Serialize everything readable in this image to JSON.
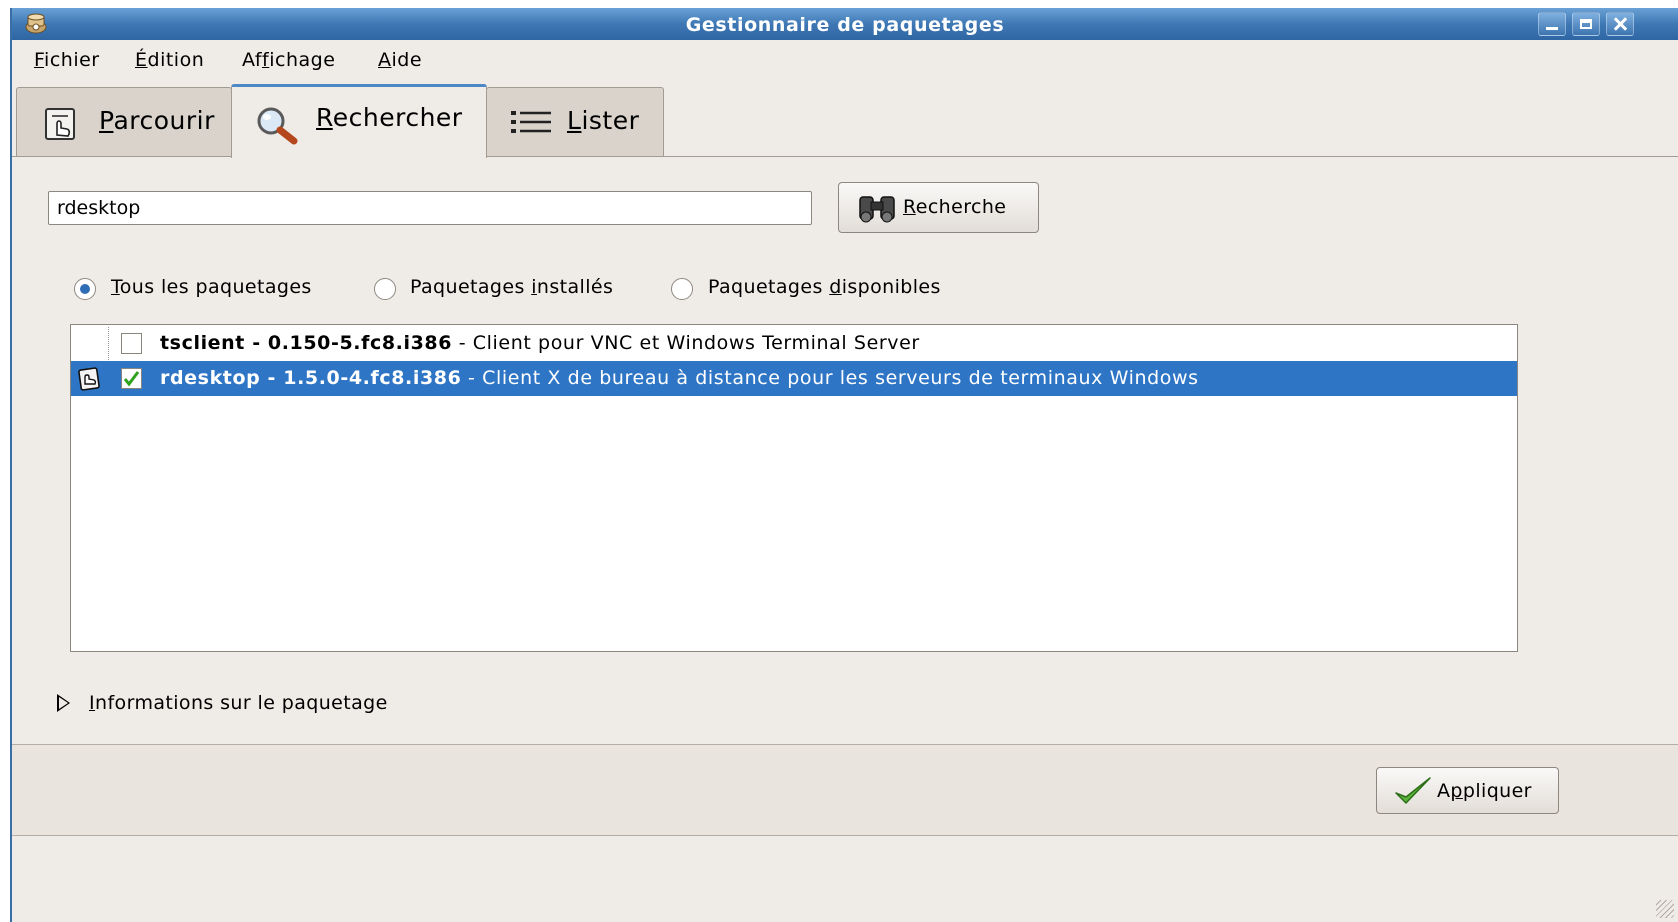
{
  "window": {
    "title": "Gestionnaire de paquetages"
  },
  "menu": [
    {
      "label_pre": "",
      "label_u": "F",
      "label_post": "ichier"
    },
    {
      "label_pre": "",
      "label_u": "É",
      "label_post": "dition"
    },
    {
      "label_pre": "Af",
      "label_u": "f",
      "label_post": "ichage"
    },
    {
      "label_pre": "",
      "label_u": "A",
      "label_post": "ide"
    }
  ],
  "tabs": [
    {
      "label_u": "P",
      "label_post": "arcourir",
      "icon": "browse-icon",
      "active": false
    },
    {
      "label_u": "R",
      "label_post": "echercher",
      "icon": "magnifier-icon",
      "active": true
    },
    {
      "label_u": "L",
      "label_post": "ister",
      "icon": "list-icon",
      "active": false
    }
  ],
  "search": {
    "value": "rdesktop",
    "button_u": "R",
    "button_post": "echerche"
  },
  "filters": [
    {
      "pre": "",
      "u": "T",
      "post": "ous les paquetages",
      "checked": true
    },
    {
      "pre": "Paquetages ",
      "u": "i",
      "post": "nstallés",
      "checked": false
    },
    {
      "pre": "Paquetages ",
      "u": "d",
      "post": "isponibles",
      "checked": false
    }
  ],
  "packages": [
    {
      "name": "tsclient - 0.150-5.fc8.i386",
      "description": " - Client pour VNC et Windows Terminal Server",
      "checked": false,
      "selected": false
    },
    {
      "name": "rdesktop - 1.5.0-4.fc8.i386",
      "description": " - Client X de bureau à distance pour les serveurs de terminaux Windows",
      "checked": true,
      "selected": true
    }
  ],
  "expander": {
    "u": "I",
    "post": "nformations sur le paquetage"
  },
  "apply": {
    "pre": "A",
    "u": "p",
    "post": "pliquer"
  },
  "colors": {
    "titlebar": "#3e78b4",
    "selection": "#2f75c5",
    "tab_active_border": "#4c88c6"
  }
}
